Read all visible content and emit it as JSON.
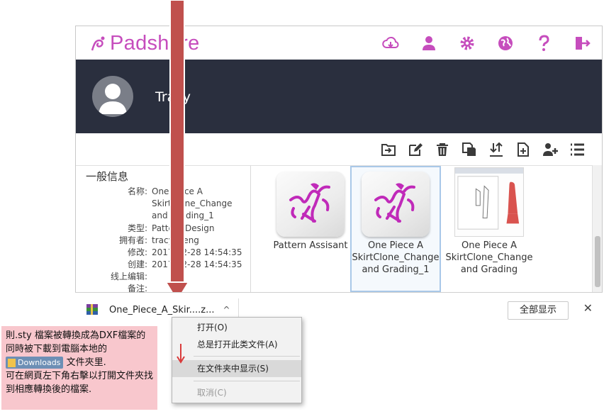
{
  "app": {
    "brand": "Padshare"
  },
  "top_icons": [
    "cloud-download-icon",
    "user-icon",
    "gear-icon",
    "globe-icon",
    "help-icon",
    "logout-icon"
  ],
  "profile": {
    "username": "Tracy"
  },
  "toolbar": [
    "move-to-folder-icon",
    "edit-icon",
    "delete-icon",
    "copy-icon",
    "download-upload-icon",
    "new-file-icon",
    "add-user-icon",
    "list-view-icon"
  ],
  "info": {
    "title": "一般信息",
    "rows": [
      {
        "label": "名称:",
        "value": "One Piece A SkirtClone_Change and Grading_1"
      },
      {
        "label": "类型:",
        "value": "Pattern Design"
      },
      {
        "label": "拥有者:",
        "value": "tracy_deng"
      },
      {
        "label": "修改:",
        "value": "2017-02-28 14:54:35"
      },
      {
        "label": "创建:",
        "value": "2017-02-28 14:54:35"
      },
      {
        "label": "线上编辑:",
        "value": ""
      },
      {
        "label": "备注:",
        "value": ""
      }
    ]
  },
  "files": [
    {
      "name": "Pattern Assisant"
    },
    {
      "name": "One Piece A SkirtClone_Change and Grading_1"
    },
    {
      "name": "One Piece A SkirtClone_Change and Grading"
    }
  ],
  "download_bar": {
    "file_name": "One_Piece_A_Skir....z...",
    "chevron": "^",
    "show_all": "全部显示",
    "close": "✕"
  },
  "context_menu": {
    "items": [
      {
        "label": "打开(O)"
      },
      {
        "label": "总是打开此类文件(A)"
      },
      {
        "label": "在文件夹中显示(S)"
      },
      {
        "label": "取消(C)"
      }
    ]
  },
  "note": {
    "line1": "則.sty 檔案被轉換成為DXF檔案的同時被下載到電腦本地的",
    "badge": "Downloads",
    "line2": "文件夾里.",
    "line3": "可在網頁左下角右擊以打開文件夾找到相應轉換後的檔案."
  },
  "colors": {
    "brand": "#c64dbd",
    "header_dark": "#2a2f3e",
    "arrow": "#c0504d",
    "note_bg": "#f8c7cd",
    "selection": "#a9c8e8"
  }
}
